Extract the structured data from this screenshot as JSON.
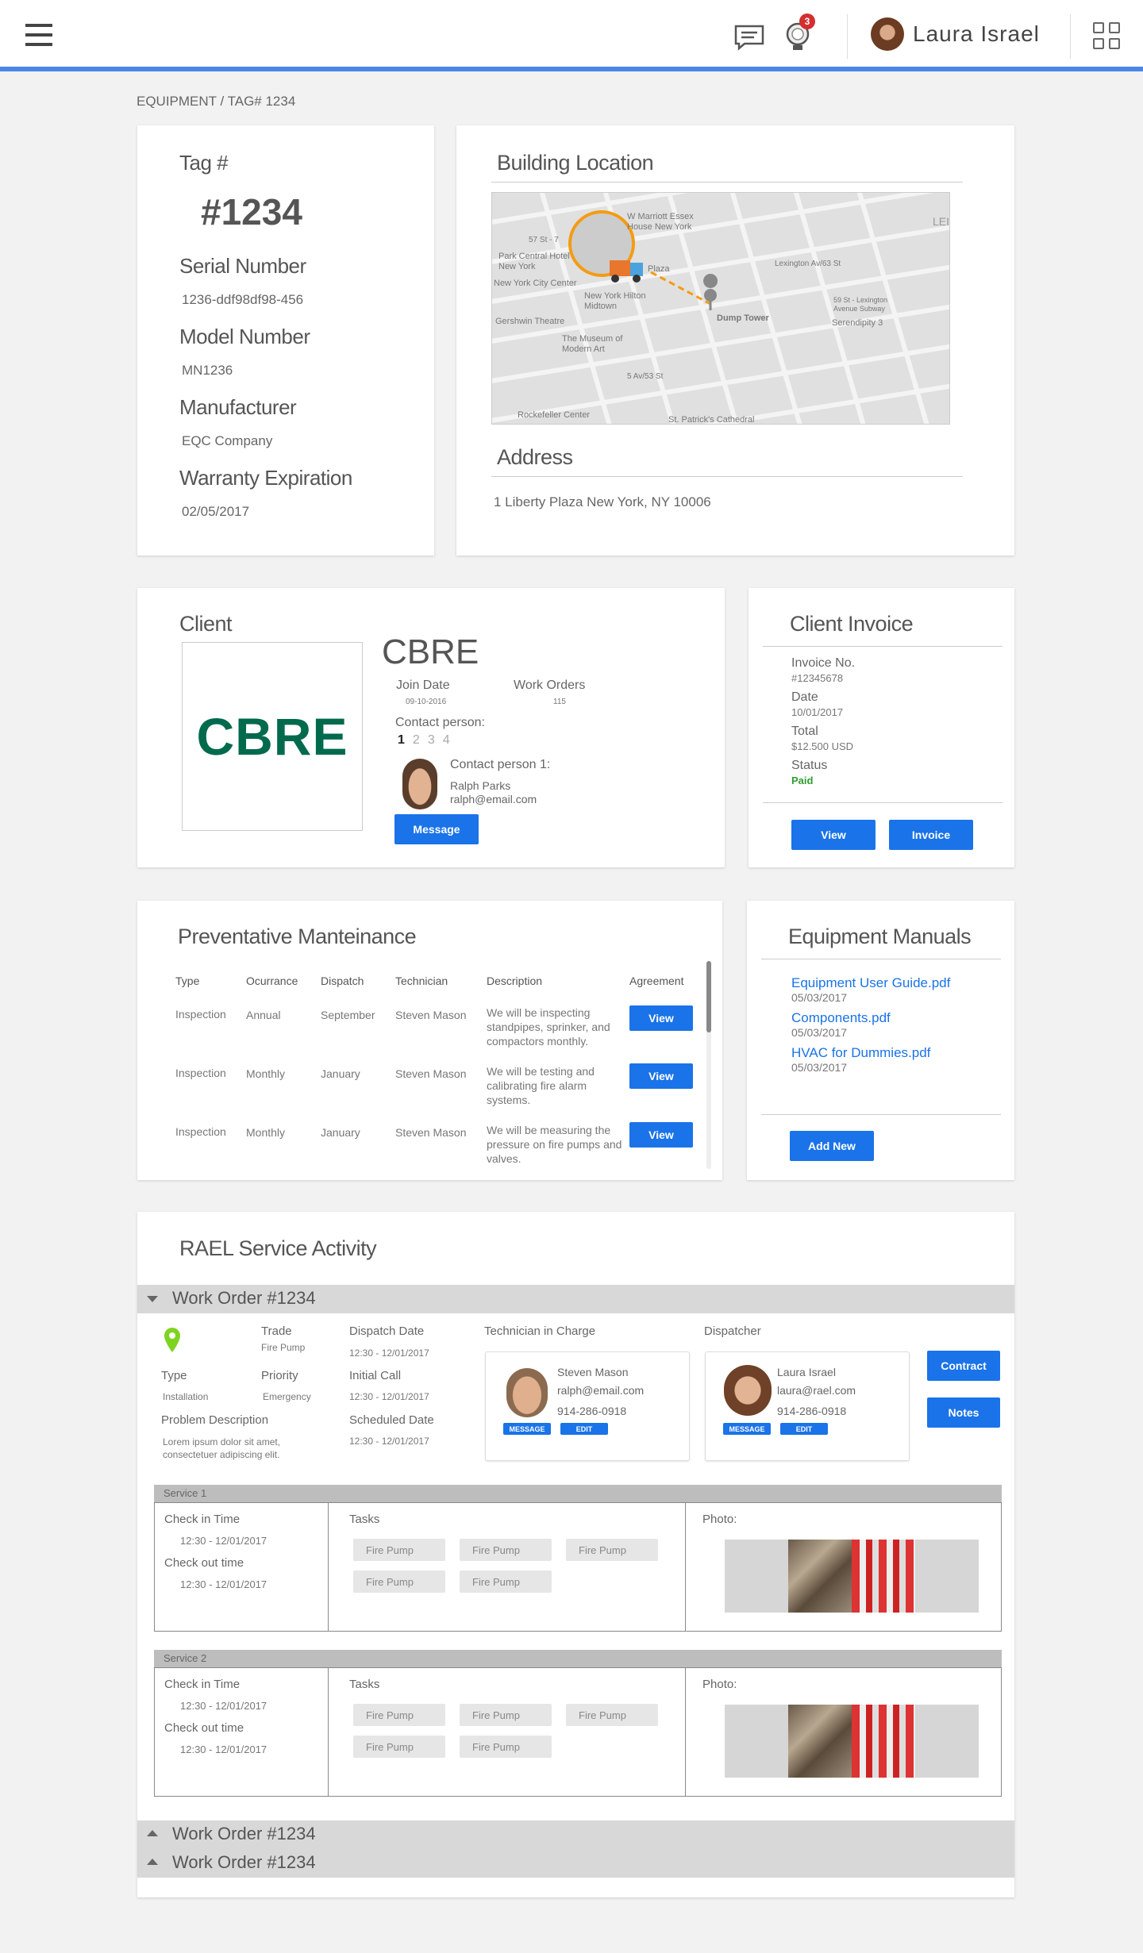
{
  "header": {
    "user_name": "Laura Israel",
    "notification_count": "3",
    "accent_color": "#4a86e8",
    "icons": [
      "menu-icon",
      "chat-icon",
      "bulb-icon",
      "grid-icon"
    ]
  },
  "breadcrumb": "EQUIPMENT / TAG# 1234",
  "equipment": {
    "tag_label": "Tag #",
    "tag_value": "#1234",
    "serial_label": "Serial Number",
    "serial_value": "1236-ddf98df98-456",
    "model_label": "Model Number",
    "model_value": "MN1236",
    "manufacturer_label": "Manufacturer",
    "manufacturer_value": "EQC Company",
    "warranty_label": "Warranty Expiration",
    "warranty_value": "02/05/2017"
  },
  "location": {
    "title": "Building Location",
    "address_label": "Address",
    "address_value": "1 Liberty Plaza New York, NY 10006",
    "map_labels": {
      "marriott": "W Marriott Essex House New York",
      "park_central": "Park Central Hotel New York",
      "city_center": "New York City Center",
      "hilton": "New York Hilton Midtown",
      "gershwin": "Gershwin Theatre",
      "moma": "The Museum of Modern Art",
      "dump": "Dump Tower",
      "serendipity": "Serendipity 3",
      "lexington": "Lexington Av/63 St",
      "lex_ave": "59 St - Lexington Avenue Subway",
      "rockefeller": "Rockefeller Center",
      "st_patricks": "St. Patrick's Cathedral",
      "plaza": "Plaza",
      "corner": "LEI",
      "street_57": "57 St - 7",
      "street_5av": "5 Av/53 St"
    }
  },
  "client": {
    "title": "Client",
    "logo_text": "CBRE",
    "logo_color": "#006a4d",
    "name": "CBRE",
    "join_label": "Join Date",
    "join_value": "09-10-2016",
    "orders_label": "Work Orders",
    "orders_value": "115",
    "contact_label": "Contact person:",
    "pages": [
      "1",
      "2",
      "3",
      "4"
    ],
    "contact_title": "Contact person 1:",
    "contact_name": "Ralph Parks",
    "contact_email": "ralph@email.com",
    "message_btn": "Message"
  },
  "invoice": {
    "title": "Client Invoice",
    "no_label": "Invoice No.",
    "no_value": "#12345678",
    "date_label": "Date",
    "date_value": "10/01/2017",
    "total_label": "Total",
    "total_value": "$12.500 USD",
    "status_label": "Status",
    "status_value": "Paid",
    "status_color": "#2e9e2e",
    "view_btn": "View",
    "invoice_btn": "Invoice"
  },
  "maintenance": {
    "title": "Preventative Manteinance",
    "columns": [
      "Type",
      "Ocurrance",
      "Dispatch",
      "Technician",
      "Description",
      "Agreement"
    ],
    "rows": [
      {
        "type": "Inspection",
        "occurrence": "Annual",
        "dispatch": "September",
        "tech": "Steven Mason",
        "desc": "We will be inspecting standpipes, sprinker, and compactors monthly.",
        "btn": "View"
      },
      {
        "type": "Inspection",
        "occurrence": "Monthly",
        "dispatch": "January",
        "tech": "Steven Mason",
        "desc": "We will be testing and calibrating fire alarm systems.",
        "btn": "View"
      },
      {
        "type": "Inspection",
        "occurrence": "Monthly",
        "dispatch": "January",
        "tech": "Steven Mason",
        "desc": "We will be measuring the pressure on fire pumps and valves.",
        "btn": "View"
      }
    ]
  },
  "manuals": {
    "title": "Equipment Manuals",
    "items": [
      {
        "name": "Equipment User Guide.pdf",
        "date": "05/03/2017"
      },
      {
        "name": "Components.pdf",
        "date": "05/03/2017"
      },
      {
        "name": "HVAC for Dummies.pdf",
        "date": "05/03/2017"
      }
    ],
    "add_btn": "Add New"
  },
  "activity": {
    "title": "RAEL Service Activity",
    "work_order_title": "Work Order #1234",
    "trade_label": "Trade",
    "trade_value": "Fire Pump",
    "type_label": "Type",
    "type_value": "Installation",
    "priority_label": "Priority",
    "priority_value": "Emergency",
    "dispatch_label": "Dispatch Date",
    "dispatch_value": "12:30 - 12/01/2017",
    "initial_label": "Initial Call",
    "initial_value": "12:30 - 12/01/2017",
    "scheduled_label": "Scheduled Date",
    "scheduled_value": "12:30 - 12/01/2017",
    "problem_label": "Problem Description",
    "problem_value": "Lorem ipsum dolor sit amet, consectetuer adipiscing elit.",
    "tech_label": "Technician in Charge",
    "tech": {
      "name": "Steven Mason",
      "email": "ralph@email.com",
      "phone": "914-286-0918",
      "message": "MESSAGE",
      "edit": "EDIT"
    },
    "dispatcher_label": "Dispatcher",
    "dispatcher": {
      "name": "Laura Israel",
      "email": "laura@rael.com",
      "phone": "914-286-0918",
      "message": "MESSAGE",
      "edit": "EDIT"
    },
    "contract_btn": "Contract",
    "notes_btn": "Notes",
    "services": [
      {
        "title": "Service 1",
        "checkin_label": "Check in Time",
        "checkin": "12:30 - 12/01/2017",
        "checkout_label": "Check out time",
        "checkout": "12:30 - 12/01/2017",
        "tasks_label": "Tasks",
        "tasks": [
          "Fire Pump",
          "Fire Pump",
          "Fire Pump",
          "Fire Pump",
          "Fire Pump"
        ],
        "photo_label": "Photo:"
      },
      {
        "title": "Service 2",
        "checkin_label": "Check in Time",
        "checkin": "12:30 - 12/01/2017",
        "checkout_label": "Check out time",
        "checkout": "12:30 - 12/01/2017",
        "tasks_label": "Tasks",
        "tasks": [
          "Fire Pump",
          "Fire Pump",
          "Fire Pump",
          "Fire Pump",
          "Fire Pump"
        ],
        "photo_label": "Photo:"
      }
    ],
    "collapsed_orders": [
      "Work Order #1234",
      "Work Order #1234"
    ]
  }
}
